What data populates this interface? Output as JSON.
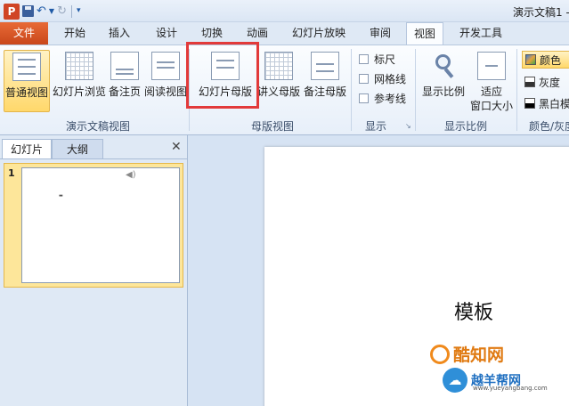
{
  "window": {
    "app_logo": "P",
    "document_title": "演示文稿1 -"
  },
  "ribbon_tabs": {
    "file": "文件",
    "tabs": [
      "开始",
      "插入",
      "设计",
      "切换",
      "动画",
      "幻灯片放映",
      "审阅",
      "视图",
      "开发工具"
    ],
    "active": "视图"
  },
  "groups": {
    "presentation_views": {
      "label": "演示文稿视图",
      "buttons": [
        "普通视图",
        "幻灯片浏览",
        "备注页",
        "阅读视图"
      ],
      "selected": "普通视图"
    },
    "master_views": {
      "label": "母版视图",
      "buttons": [
        "幻灯片母版",
        "讲义母版",
        "备注母版"
      ],
      "highlighted": "幻灯片母版"
    },
    "show": {
      "label": "显示",
      "checkboxes": [
        "标尺",
        "网格线",
        "参考线"
      ]
    },
    "zoom": {
      "label": "显示比例",
      "zoom_button": "显示比例",
      "fit_line1": "适应",
      "fit_line2": "窗口大小"
    },
    "color": {
      "label": "颜色/灰度",
      "options": [
        "颜色",
        "灰度",
        "黑白模"
      ],
      "selected": "颜色"
    }
  },
  "slides_panel": {
    "tab_slides": "幻灯片",
    "tab_outline": "大纲",
    "close_glyph": "✕",
    "slide_number": "1"
  },
  "slide": {
    "title": "模板"
  },
  "watermarks": {
    "site1": "酷知网",
    "site2": "越羊帮网",
    "site2_url": "www.yueyangbang.com"
  },
  "colors": {
    "file_tab": "#d35a2a",
    "highlight_box": "#e23a3a",
    "selected_button": "#ffd86b"
  }
}
